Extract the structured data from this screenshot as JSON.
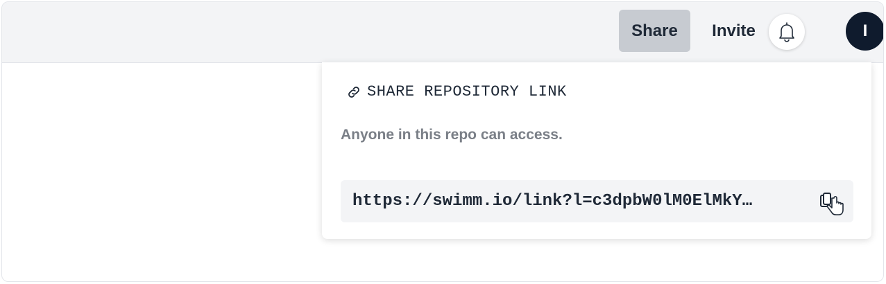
{
  "header": {
    "share_label": "Share",
    "invite_label": "Invite",
    "avatar_initial": "I",
    "bell_icon": "bell-icon"
  },
  "share_popover": {
    "title": "SHARE REPOSITORY LINK",
    "title_icon": "link-icon",
    "description": "Anyone in this repo can access.",
    "link_url": "https://swimm.io/link?l=c3dpbW0lM0ElMkY…",
    "copy_icon": "copy-icon",
    "cursor_icon": "hand-pointer-cursor-icon"
  },
  "colors": {
    "topbar_bg": "#f3f4f6",
    "share_active_bg": "#c7cbd1",
    "avatar_bg": "#0f1b2d",
    "text_dark": "#1f2937",
    "text_muted": "#7a7f87"
  }
}
